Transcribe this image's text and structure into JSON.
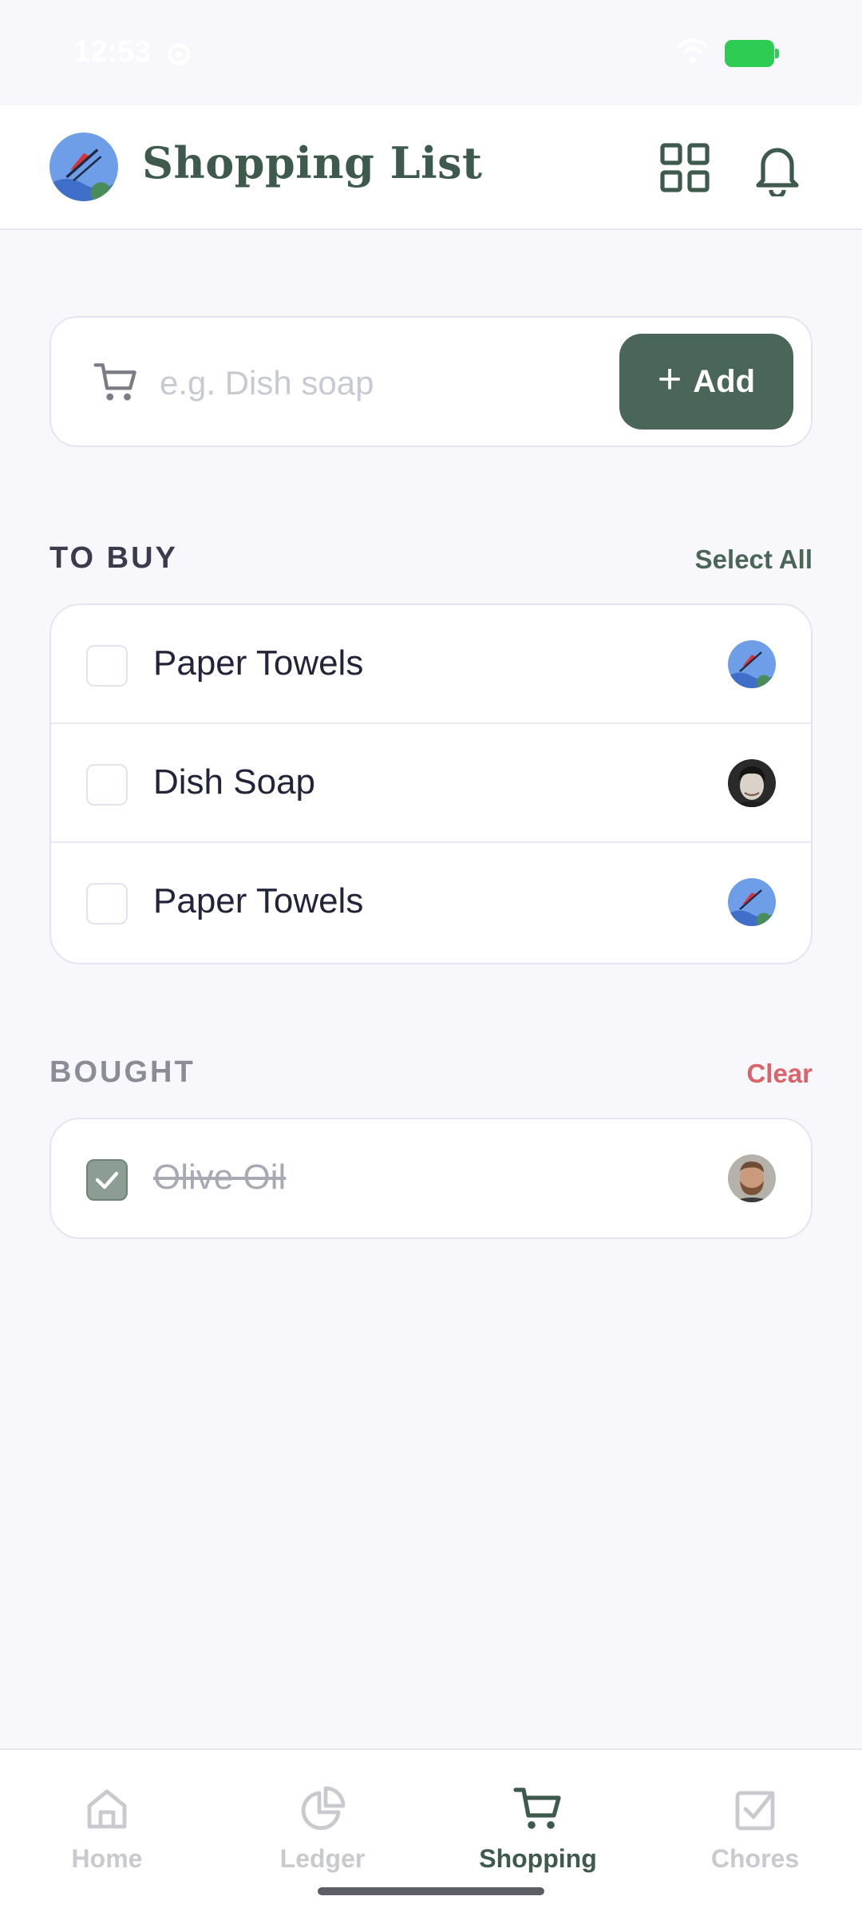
{
  "status_bar": {
    "time": "12:53"
  },
  "header": {
    "title": "Shopping List"
  },
  "add_item": {
    "placeholder": "e.g. Dish soap",
    "button_label": "Add"
  },
  "to_buy": {
    "title": "TO BUY",
    "action": "Select All",
    "items": [
      {
        "label": "Paper Towels",
        "checked": false,
        "avatar": "skier-avatar"
      },
      {
        "label": "Dish Soap",
        "checked": false,
        "avatar": "man-avatar"
      },
      {
        "label": "Paper Towels",
        "checked": false,
        "avatar": "skier-avatar"
      }
    ]
  },
  "bought": {
    "title": "BOUGHT",
    "action": "Clear",
    "items": [
      {
        "label": "Olive Oil",
        "checked": true,
        "avatar": "bearded-man-avatar"
      }
    ]
  },
  "nav": {
    "items": [
      {
        "label": "Home",
        "icon": "home-icon"
      },
      {
        "label": "Ledger",
        "icon": "pie-chart-icon"
      },
      {
        "label": "Shopping",
        "icon": "cart-icon",
        "active": true
      },
      {
        "label": "Chores",
        "icon": "checkbox-icon"
      }
    ]
  },
  "colors": {
    "accent": "#4a6658",
    "title": "#3e5a4c",
    "clear": "#d9646a",
    "background": "#f7f7fc"
  }
}
